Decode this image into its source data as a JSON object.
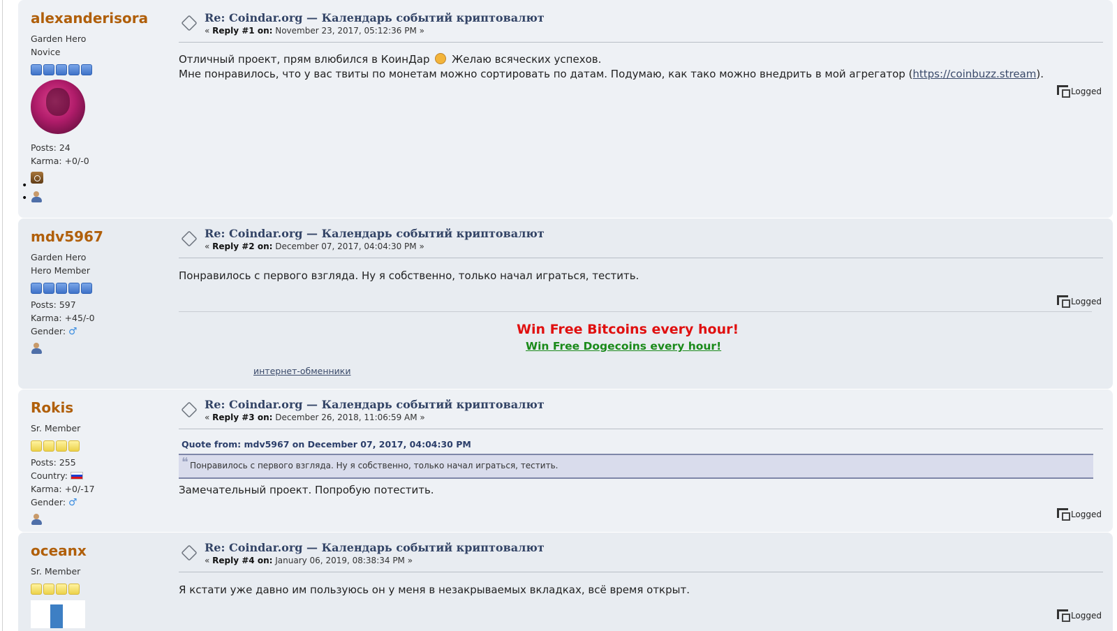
{
  "posts": [
    {
      "author": "alexanderisora",
      "group": "Garden Hero",
      "rank": "Novice",
      "posts_label": "Posts: 24",
      "karma_label": "Karma: +0/-0",
      "subject": "Re: Coindar.org — Календарь событий криптовалют",
      "reply_prefix": "« ",
      "reply_label": "Reply #1 on:",
      "reply_date": "November 23, 2017, 05:12:36 PM »",
      "body_line1a": "Отличный проект, прям влюбился в КоинДар",
      "body_line1b": "Желаю всяческих успехов.",
      "body_line2a": "Мне понравилось, что у вас твиты по монетам можно сортировать по датам. Подумаю, как тако можно внедрить в мой агрегатор (",
      "body_link": "https://coinbuzz.stream",
      "body_line2b": ").",
      "logged": "Logged"
    },
    {
      "author": "mdv5967",
      "group": "Garden Hero",
      "rank": "Hero Member",
      "posts_label": "Posts: 597",
      "karma_label": "Karma: +45/-0",
      "gender_label": "Gender:",
      "subject": "Re: Coindar.org — Календарь событий криптовалют",
      "reply_prefix": "« ",
      "reply_label": "Reply #2 on:",
      "reply_date": "December 07, 2017, 04:04:30 PM »",
      "body": "Понравилось с первого взгляда. Ну я собственно, только начал играться, тестить.",
      "logged": "Logged",
      "ad_bitcoin": "Win Free Bitcoins every hour!",
      "ad_dogecoin": "Win Free Dogecoins every hour!",
      "ad_link": "интернет-обменники"
    },
    {
      "author": "Rokis",
      "rank": "Sr. Member",
      "posts_label": "Posts: 255",
      "country_label": "Country:",
      "karma_label": "Karma: +0/-17",
      "gender_label": "Gender:",
      "subject": "Re: Coindar.org — Календарь событий криптовалют",
      "reply_prefix": "« ",
      "reply_label": "Reply #3 on:",
      "reply_date": "December 26, 2018, 11:06:59 AM »",
      "quote_header": "Quote from: mdv5967 on December 07, 2017, 04:04:30 PM",
      "quote_text": "Понравилось с первого взгляда. Ну я собственно, только начал играться, тестить.",
      "body": "Замечательный проект. Попробую потестить.",
      "logged": "Logged"
    },
    {
      "author": "oceanx",
      "rank": "Sr. Member",
      "subject": "Re: Coindar.org — Календарь событий криптовалют",
      "reply_prefix": "« ",
      "reply_label": "Reply #4 on:",
      "reply_date": "January 06, 2019, 08:38:34 PM »",
      "body": "Я кстати уже давно им пользуюсь он у меня в незакрываемых вкладках, всё время открыт.",
      "logged": "Logged"
    }
  ],
  "colors": {
    "author": "#b05f0a",
    "subject": "#334466",
    "ad_bitcoin": "#e01010",
    "ad_dogecoin": "#1a8a1a",
    "post_bg": "#e8ecf1"
  },
  "icons": [
    "topic-icon",
    "star-icon",
    "instagram-icon",
    "profile-icon",
    "logged-icon",
    "smiley-icon",
    "male-icon",
    "russia-flag-icon"
  ]
}
